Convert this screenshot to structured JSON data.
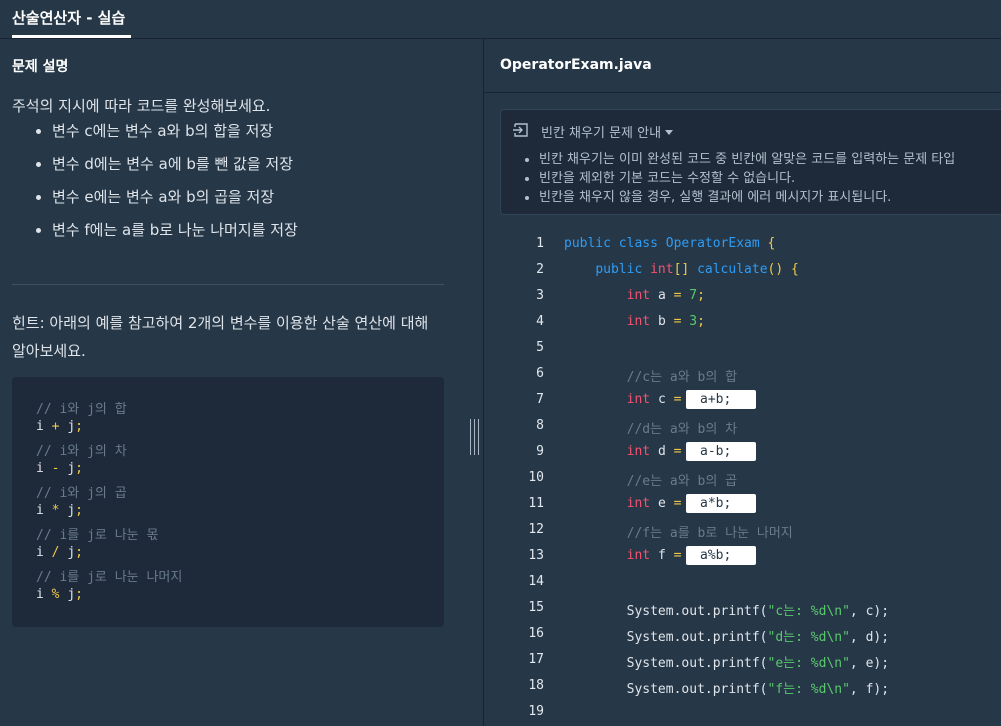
{
  "tab": {
    "title": "산술연산자 - 실습"
  },
  "left": {
    "section_title": "문제 설명",
    "description": "주석의 지시에 따라 코드를 완성해보세요.",
    "tasks": [
      "변수 c에는 변수 a와 b의 합을 저장",
      "변수 d에는 변수 a에 b를 뺀 값을 저장",
      "변수 e에는 변수 a와 b의 곱을 저장",
      "변수 f에는 a를 b로 나눈 나머지를 저장"
    ],
    "hint": "힌트: 아래의 예를 참고하여 2개의 변수를 이용한 산술 연산에 대해 알아보세요.",
    "hint_code": [
      {
        "comment": "// i와 j의 합"
      },
      {
        "a": "i",
        "op": "+",
        "b": "j",
        "end": ";"
      },
      {
        "comment": "// i와 j의 차"
      },
      {
        "a": "i",
        "op": "-",
        "b": "j",
        "end": ";"
      },
      {
        "comment": "// i와 j의 곱"
      },
      {
        "a": "i",
        "op": "*",
        "b": "j",
        "end": ";"
      },
      {
        "comment": "// i를 j로 나눈 몫"
      },
      {
        "a": "i",
        "op": "/",
        "b": "j",
        "end": ";"
      },
      {
        "comment": "// i를 j로 나눈 나머지"
      },
      {
        "a": "i",
        "op": "%",
        "b": "j",
        "end": ";"
      }
    ]
  },
  "right": {
    "file_name": "OperatorExam.java",
    "notice": {
      "title": "빈칸 채우기 문제 안내",
      "items": [
        "빈칸 채우기는 이미 완성된 코드 중 빈칸에 알맞은 코드를 입력하는 문제 타입",
        "빈칸을 제외한 기본 코드는 수정할 수 없습니다.",
        "빈칸을 채우지 않을 경우, 실행 결과에 에러 메시지가 표시됩니다."
      ]
    },
    "line_numbers": [
      "1",
      "2",
      "3",
      "4",
      "5",
      "6",
      "7",
      "8",
      "9",
      "10",
      "11",
      "12",
      "13",
      "14",
      "15",
      "16",
      "17",
      "18",
      "19"
    ],
    "code": {
      "l1": {
        "kw1": "public",
        "kw2": "class",
        "cls": "OperatorExam",
        "brace": "{"
      },
      "l2": {
        "kw1": "public",
        "type": "int",
        "arr": "[]",
        "fn": "calculate",
        "paren": "()",
        "brace": "{"
      },
      "l3": {
        "type": "int",
        "name": "a",
        "eq": "=",
        "num": "7",
        "end": ";"
      },
      "l4": {
        "type": "int",
        "name": "b",
        "eq": "=",
        "num": "3",
        "end": ";"
      },
      "l6": "//c는 a와 b의 합",
      "l7": {
        "type": "int",
        "name": "c",
        "eq": "="
      },
      "l8": "//d는 a와 b의 차",
      "l9": {
        "type": "int",
        "name": "d",
        "eq": "="
      },
      "l10": "//e는 a와 b의 곱",
      "l11": {
        "type": "int",
        "name": "e",
        "eq": "="
      },
      "l12": "//f는 a를 b로 나눈 나머지",
      "l13": {
        "type": "int",
        "name": "f",
        "eq": "="
      },
      "prints": [
        {
          "pre": "System.out.printf(",
          "str": "\"c는: %d\\n\"",
          "post": ", c);"
        },
        {
          "pre": "System.out.printf(",
          "str": "\"d는: %d\\n\"",
          "post": ", d);"
        },
        {
          "pre": "System.out.printf(",
          "str": "\"e는: %d\\n\"",
          "post": ", e);"
        },
        {
          "pre": "System.out.printf(",
          "str": "\"f는: %d\\n\"",
          "post": ", f);"
        }
      ]
    },
    "blanks": {
      "c": "a+b;",
      "d": "a-b;",
      "e": "a*b;",
      "f": "a%b;"
    }
  },
  "colors": {
    "background": "#263747",
    "panel_dark": "#1e2a39",
    "keyword": "#f05471",
    "class_fn": "#2e9cf5",
    "number_string": "#5ac96e",
    "operator": "#f0c94a",
    "comment": "#697b8d"
  },
  "icons": {
    "notice": "expand-panel-icon",
    "dropdown": "caret-down-icon"
  }
}
